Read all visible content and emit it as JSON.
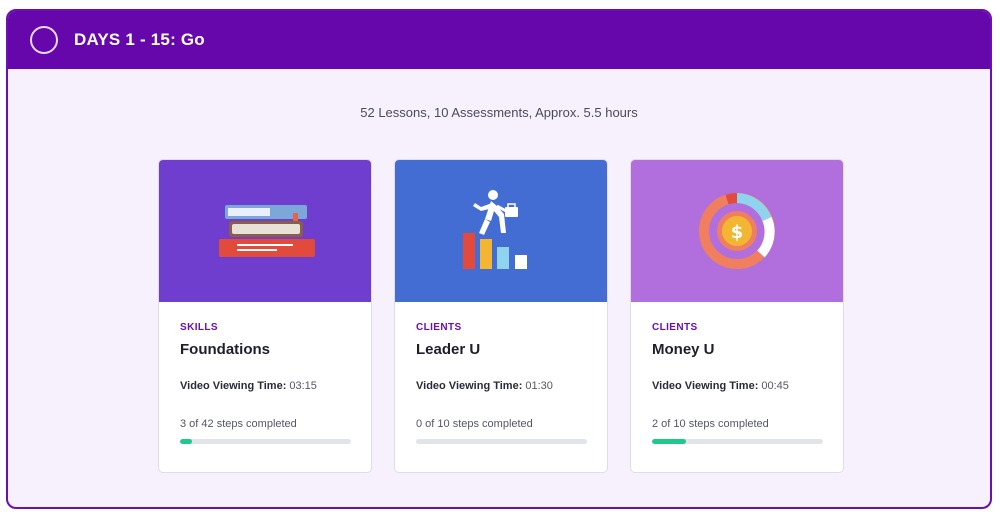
{
  "module": {
    "title": "DAYS 1 - 15: Go",
    "summary": "52 Lessons, 10 Assessments, Approx. 5.5 hours"
  },
  "cards": [
    {
      "category": "SKILLS",
      "title": "Foundations",
      "viewing_label": "Video Viewing Time:",
      "viewing_value": "03:15",
      "steps_text": "3 of 42 steps completed",
      "progress": 0.071,
      "hero_color": "#6f3ecf",
      "icon": "books-icon"
    },
    {
      "category": "CLIENTS",
      "title": "Leader U",
      "viewing_label": "Video Viewing Time:",
      "viewing_value": "01:30",
      "steps_text": "0 of 10 steps completed",
      "progress": 0.0,
      "hero_color": "#436dd3",
      "icon": "climbing-stairs-icon"
    },
    {
      "category": "CLIENTS",
      "title": "Money U",
      "viewing_label": "Video Viewing Time:",
      "viewing_value": "00:45",
      "steps_text": "2 of 10 steps completed",
      "progress": 0.2,
      "hero_color": "#b06fdd",
      "icon": "money-donut-icon"
    }
  ],
  "colors": {
    "header": "#6607ac",
    "accent": "#6a0fb0",
    "progress": "#1fc98b",
    "background": "#f6f1fd"
  }
}
